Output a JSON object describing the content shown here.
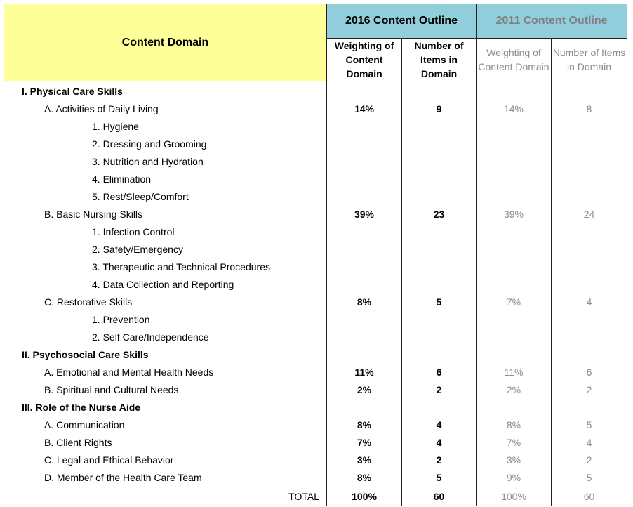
{
  "table": {
    "domain_header": "Content Domain",
    "outline_2016": "2016 Content Outline",
    "outline_2011": "2011 Content Outline",
    "sub_headers_2016": [
      "Weighting of Content Domain",
      "Number of Items in Domain"
    ],
    "sub_headers_2011": [
      "Weighting of Content Domain",
      "Number of Items in Domain"
    ],
    "rows": [
      {
        "label": "I. Physical Care Skills",
        "level": 0,
        "w2016": "",
        "n2016": "",
        "w2011": "",
        "n2011": ""
      },
      {
        "label": "A.  Activities of Daily Living",
        "level": 1,
        "w2016": "14%",
        "n2016": "9",
        "w2011": "14%",
        "n2011": "8"
      },
      {
        "label": "1. Hygiene",
        "level": 2,
        "w2016": "",
        "n2016": "",
        "w2011": "",
        "n2011": ""
      },
      {
        "label": "2. Dressing and Grooming",
        "level": 2,
        "w2016": "",
        "n2016": "",
        "w2011": "",
        "n2011": ""
      },
      {
        "label": "3. Nutrition and Hydration",
        "level": 2,
        "w2016": "",
        "n2016": "",
        "w2011": "",
        "n2011": ""
      },
      {
        "label": "4. Elimination",
        "level": 2,
        "w2016": "",
        "n2016": "",
        "w2011": "",
        "n2011": ""
      },
      {
        "label": "5. Rest/Sleep/Comfort",
        "level": 2,
        "w2016": "",
        "n2016": "",
        "w2011": "",
        "n2011": ""
      },
      {
        "label": "B.  Basic Nursing Skills",
        "level": 1,
        "w2016": "39%",
        "n2016": "23",
        "w2011": "39%",
        "n2011": "24"
      },
      {
        "label": "1. Infection Control",
        "level": 2,
        "w2016": "",
        "n2016": "",
        "w2011": "",
        "n2011": ""
      },
      {
        "label": "2. Safety/Emergency",
        "level": 2,
        "w2016": "",
        "n2016": "",
        "w2011": "",
        "n2011": ""
      },
      {
        "label": "3. Therapeutic and Technical Procedures",
        "level": 2,
        "w2016": "",
        "n2016": "",
        "w2011": "",
        "n2011": ""
      },
      {
        "label": "4. Data Collection and Reporting",
        "level": 2,
        "w2016": "",
        "n2016": "",
        "w2011": "",
        "n2011": ""
      },
      {
        "label": "C.  Restorative Skills",
        "level": 1,
        "w2016": "8%",
        "n2016": "5",
        "w2011": "7%",
        "n2011": "4"
      },
      {
        "label": "1. Prevention",
        "level": 2,
        "w2016": "",
        "n2016": "",
        "w2011": "",
        "n2011": ""
      },
      {
        "label": "2. Self Care/Independence",
        "level": 2,
        "w2016": "",
        "n2016": "",
        "w2011": "",
        "n2011": ""
      },
      {
        "label": "II. Psychosocial Care Skills",
        "level": 0,
        "w2016": "",
        "n2016": "",
        "w2011": "",
        "n2011": ""
      },
      {
        "label": "A.  Emotional and Mental Health Needs",
        "level": 1,
        "w2016": "11%",
        "n2016": "6",
        "w2011": "11%",
        "n2011": "6"
      },
      {
        "label": "B.  Spiritual and Cultural Needs",
        "level": 1,
        "w2016": "2%",
        "n2016": "2",
        "w2011": "2%",
        "n2011": "2"
      },
      {
        "label": "III. Role of the Nurse Aide",
        "level": 0,
        "w2016": "",
        "n2016": "",
        "w2011": "",
        "n2011": ""
      },
      {
        "label": "A.  Communication",
        "level": 1,
        "w2016": "8%",
        "n2016": "4",
        "w2011": "8%",
        "n2011": "5"
      },
      {
        "label": "B.  Client Rights",
        "level": 1,
        "w2016": "7%",
        "n2016": "4",
        "w2011": "7%",
        "n2011": "4"
      },
      {
        "label": "C.  Legal and Ethical Behavior",
        "level": 1,
        "w2016": "3%",
        "n2016": "2",
        "w2011": "3%",
        "n2011": "2"
      },
      {
        "label": "D.  Member of the Health Care Team",
        "level": 1,
        "w2016": "8%",
        "n2016": "5",
        "w2011": "9%",
        "n2011": "5"
      }
    ],
    "total": {
      "label": "TOTAL",
      "w2016": "100%",
      "n2016": "60",
      "w2011": "100%",
      "n2011": "60"
    }
  },
  "colors": {
    "domain_header_bg": "#FFFF99",
    "outline_header_bg": "#92CDDC",
    "old_text": "#8c8c8c"
  }
}
